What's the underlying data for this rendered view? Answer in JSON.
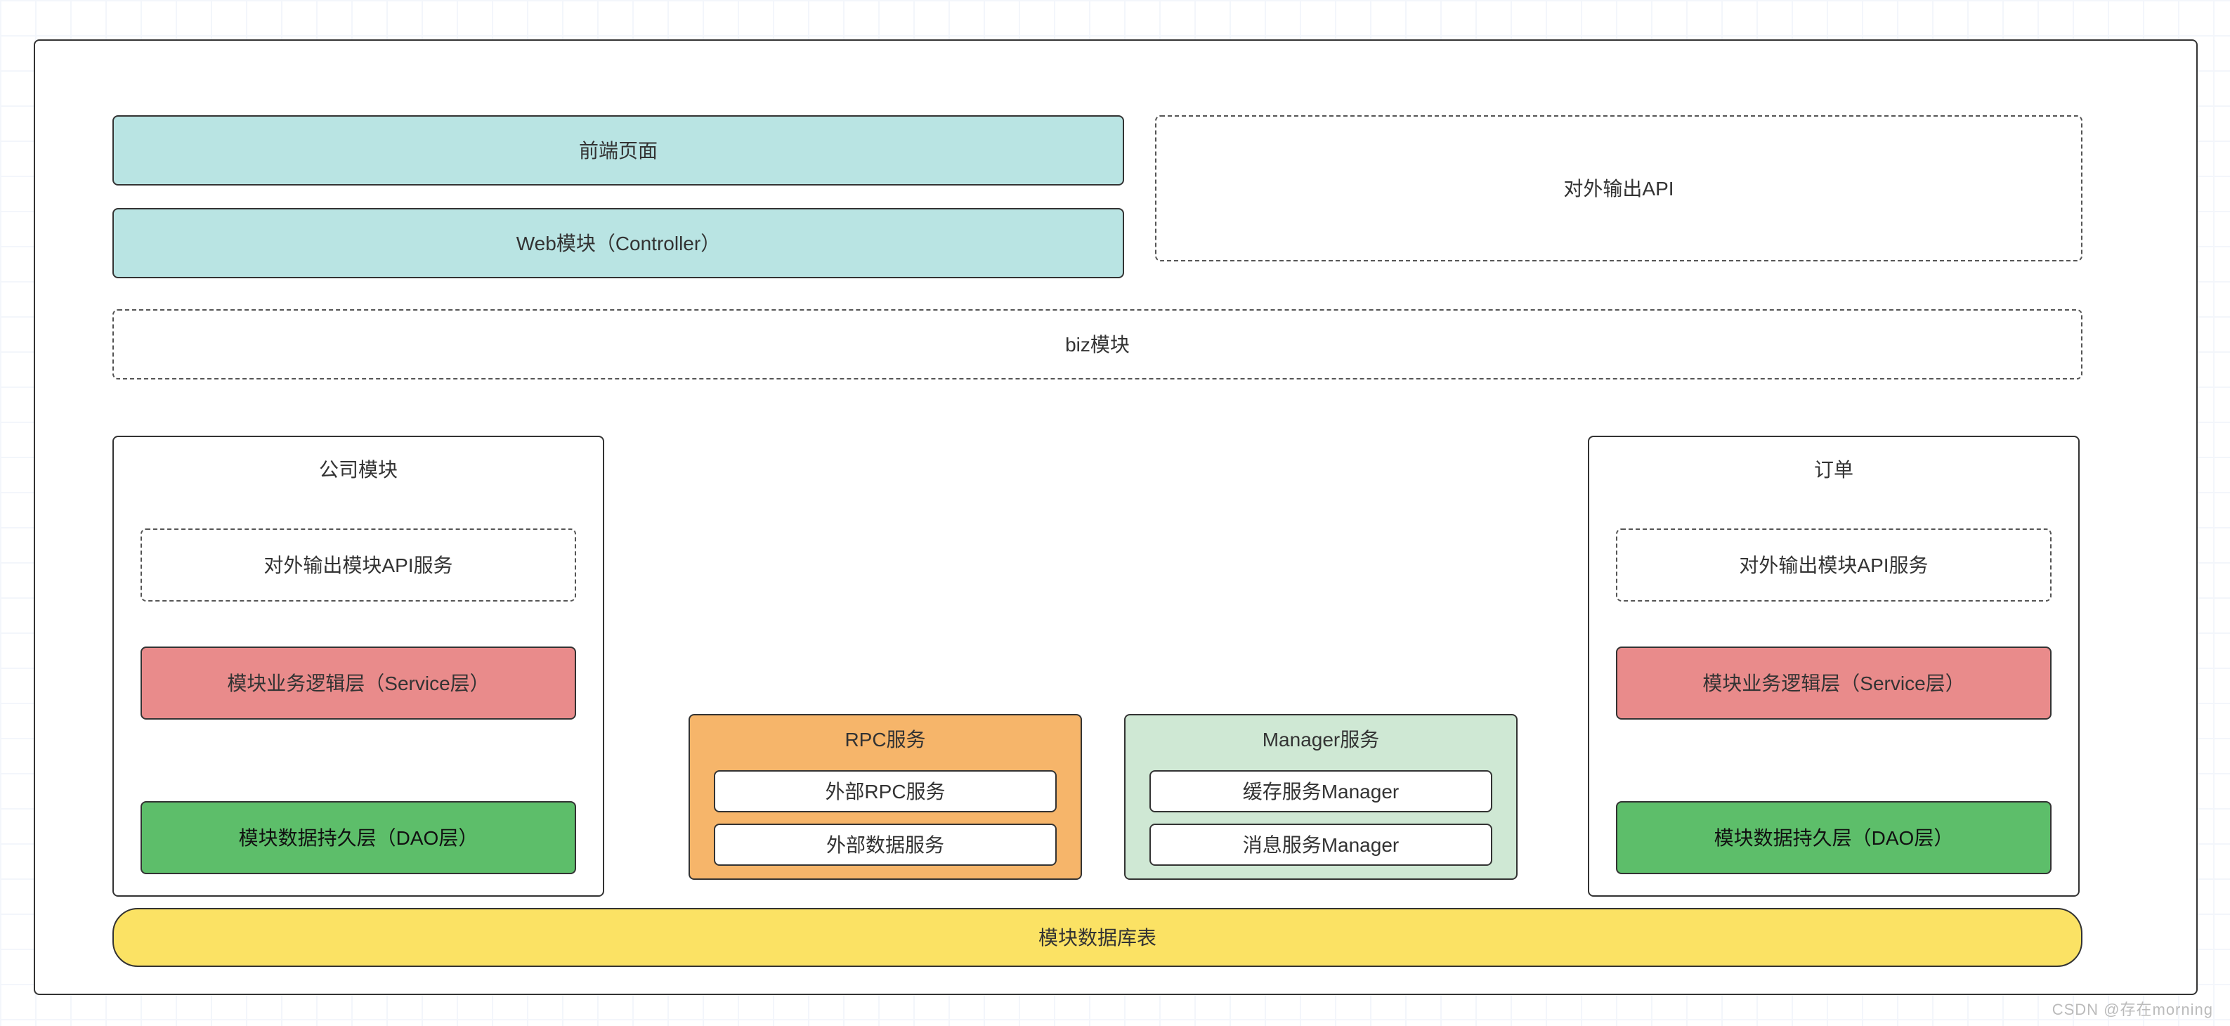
{
  "frontend_page": "前端页面",
  "web_module": "Web模块（Controller）",
  "external_api": "对外输出API",
  "biz_module": "biz模块",
  "company_module": {
    "title": "公司模块",
    "api_service": "对外输出模块API服务",
    "service_layer": "模块业务逻辑层（Service层）",
    "dao_layer": "模块数据持久层（DAO层）"
  },
  "order_module": {
    "title": "订单",
    "api_service": "对外输出模块API服务",
    "service_layer": "模块业务逻辑层（Service层）",
    "dao_layer": "模块数据持久层（DAO层）"
  },
  "rpc": {
    "title": "RPC服务",
    "item1": "外部RPC服务",
    "item2": "外部数据服务"
  },
  "manager": {
    "title": "Manager服务",
    "item1": "缓存服务Manager",
    "item2": "消息服务Manager"
  },
  "db_table": "模块数据库表",
  "watermark": "CSDN @存在morning"
}
